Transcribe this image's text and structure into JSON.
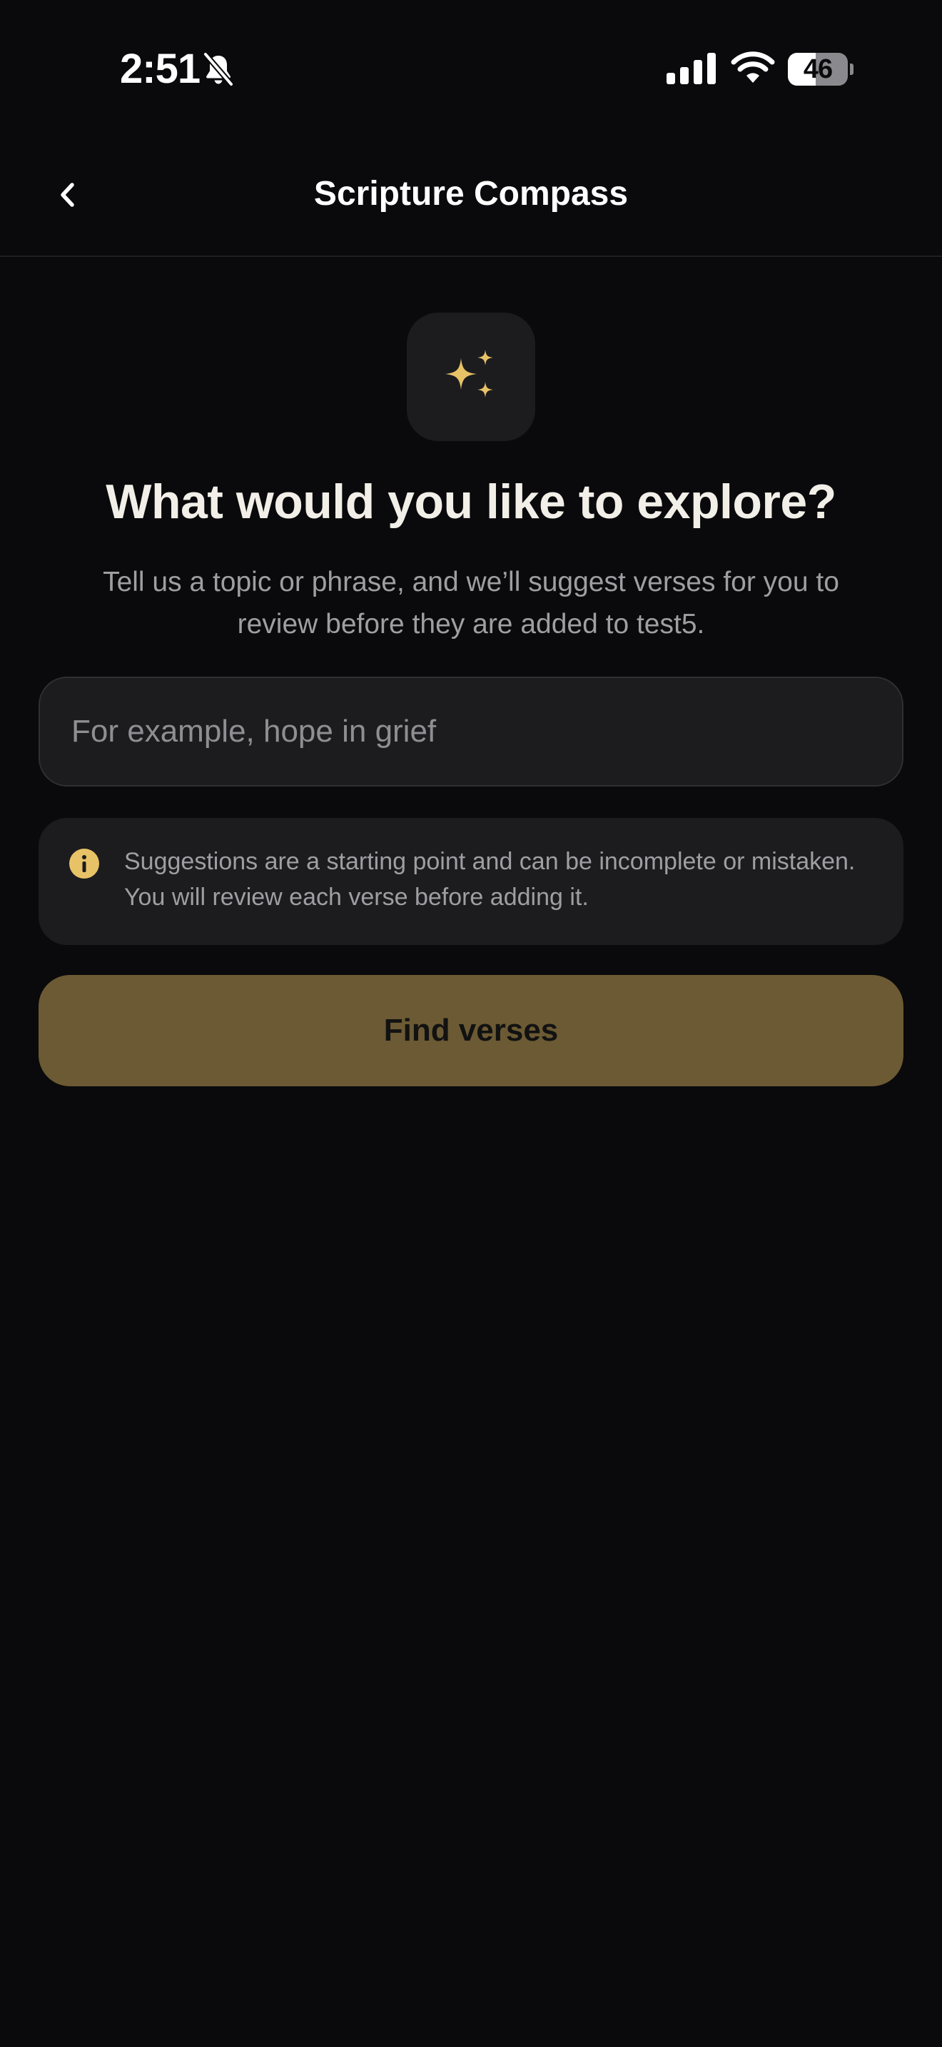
{
  "status_bar": {
    "time": "2:51",
    "battery_level": "46",
    "battery_fraction": 0.46,
    "icons": [
      "bell-slash-icon",
      "cellular-signal-icon",
      "wifi-icon",
      "battery-icon"
    ]
  },
  "nav": {
    "title": "Scripture Compass",
    "back_icon": "chevron-left-icon"
  },
  "main": {
    "hero_icon": "sparkles-icon",
    "headline": "What would you like to explore?",
    "subtext": "Tell us a topic or phrase, and we’ll suggest verses for you to review before they are added to test5.",
    "input": {
      "placeholder": "For example, hope in grief",
      "value": ""
    },
    "info": {
      "icon": "info-icon",
      "text": "Suggestions are a starting point and can be incomplete or mistaken. You will review each verse before adding it."
    },
    "find_button_label": "Find verses"
  },
  "colors": {
    "background": "#0a0a0c",
    "surface": "#1c1c1f",
    "accent_gold": "#e8c266",
    "button_fill": "#6b5a33",
    "muted_text": "#9e9ea3"
  }
}
